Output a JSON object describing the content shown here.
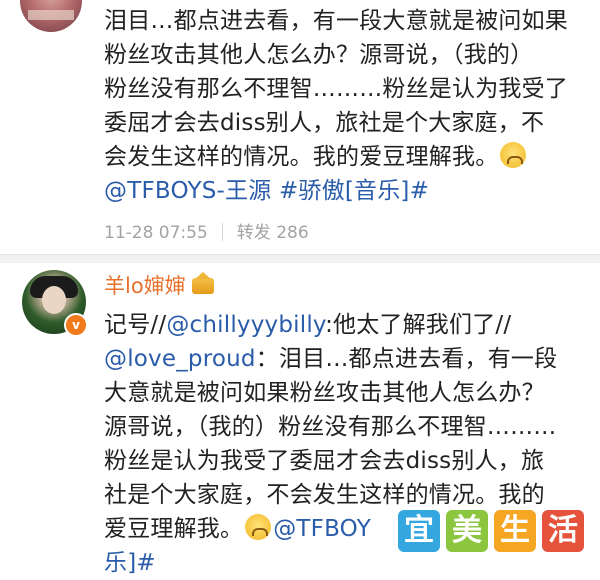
{
  "post_top": {
    "lines": [
      "泪目…都点进去看，有一段大意就是被问如果",
      "粉丝攻击其他人怎么办？源哥说，（我的）",
      "粉丝没有那么不理智………粉丝是认为我受了",
      "委屈才会去diss别人，旅社是个大家庭，不",
      "会发生这样的情况。我的爱豆理解我。"
    ],
    "mention_line": "@TFBOYS-王源 #骄傲[音乐]#",
    "timestamp": "11-28 07:55",
    "repost_label": "转发 286"
  },
  "post_user": {
    "username": "羊lo婶婶",
    "verified_mark": "v",
    "lines_prefix": "记号//",
    "mention1": "@chillyyybilly",
    "line1_rest": ":他太了解我们了//",
    "mention2": "@love_proud",
    "line2_rest": "：泪目…都点进去看，有一段",
    "lines": [
      "大意就是被问如果粉丝攻击其他人怎么办？",
      "源哥说，（我的）粉丝没有那么不理智………",
      "粉丝是认为我受了委屈才会去diss别人，旅",
      "社是个大家庭，不会发生这样的情况。我的"
    ],
    "last_line_text": "爱豆理解我。",
    "last_line_mention": "@TFBOY",
    "cut_line": "乐]#"
  },
  "watermark": {
    "chars": [
      "宜",
      "美",
      "生",
      "活"
    ]
  },
  "icons": {
    "emoji": "crying-face-icon",
    "crown": "crown-icon"
  },
  "colors": {
    "link": "#2a5caa",
    "username": "#e8702a",
    "meta": "#a3a3a3"
  }
}
